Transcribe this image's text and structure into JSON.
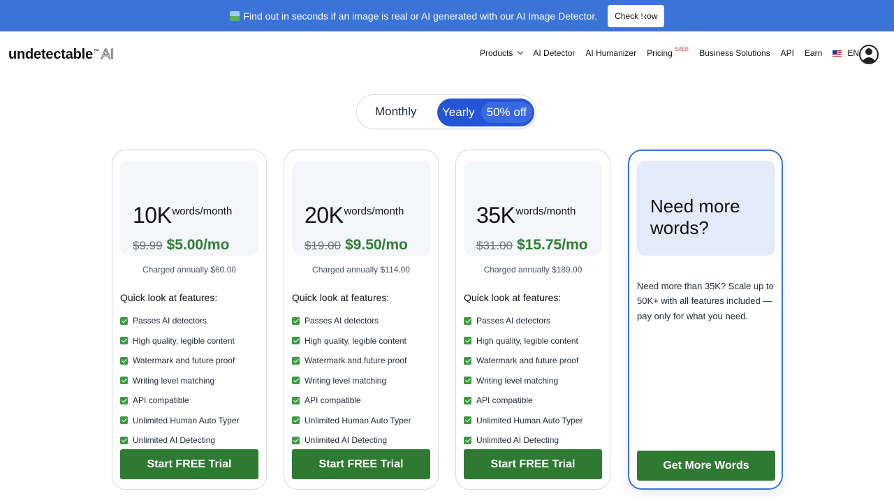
{
  "banner": {
    "icon": "framed-picture-icon",
    "text": "Find out in seconds if an image is real or AI generated with our AI Image Detector.",
    "button": "Check Now",
    "close": "×"
  },
  "header": {
    "logo": {
      "main": "undetectable",
      "tm": "™",
      "ai": "AI"
    },
    "nav": {
      "products": "Products",
      "ai_detector": "AI Detector",
      "ai_humanizer": "AI Humanizer",
      "pricing": "Pricing",
      "sale": "SALE",
      "business": "Business Solutions",
      "api": "API",
      "earn": "Earn",
      "language": "EN"
    }
  },
  "billing_toggle": {
    "monthly": "Monthly",
    "yearly": "Yearly",
    "discount": "50% off",
    "selected": "Yearly"
  },
  "colors": {
    "banner": "#3b74d6",
    "toggle_active": "#2555d6",
    "price": "#2e7d32",
    "cta": "#2f7a33"
  },
  "plans": [
    {
      "words": "10K",
      "unit": "words/month",
      "old_price": "$9.99",
      "new_price": "$5.00/mo",
      "charged": "Charged annually $60.00",
      "features_title": "Quick look at features:",
      "features": [
        "Passes AI detectors",
        "High quality, legible content",
        "Watermark and future proof",
        "Writing level matching",
        "API compatible",
        "Unlimited Human Auto Typer",
        "Unlimited AI Detecting"
      ],
      "cta": "Start FREE Trial"
    },
    {
      "words": "20K",
      "unit": "words/month",
      "old_price": "$19.00",
      "new_price": "$9.50/mo",
      "charged": "Charged annually $114.00",
      "features_title": "Quick look at features:",
      "features": [
        "Passes AI detectors",
        "High quality, legible content",
        "Watermark and future proof",
        "Writing level matching",
        "API compatible",
        "Unlimited Human Auto Typer",
        "Unlimited AI Detecting"
      ],
      "cta": "Start FREE Trial"
    },
    {
      "words": "35K",
      "unit": "words/month",
      "old_price": "$31.00",
      "new_price": "$15.75/mo",
      "charged": "Charged annually $189.00",
      "features_title": "Quick look at features:",
      "features": [
        "Passes AI detectors",
        "High quality, legible content",
        "Watermark and future proof",
        "Writing level matching",
        "API compatible",
        "Unlimited Human Auto Typer",
        "Unlimited AI Detecting"
      ],
      "cta": "Start FREE Trial"
    }
  ],
  "custom_plan": {
    "title": "Need more words?",
    "description": "Need more than 35K? Scale up to 50K+ with all features included — pay only for what you need.",
    "cta": "Get More Words"
  }
}
